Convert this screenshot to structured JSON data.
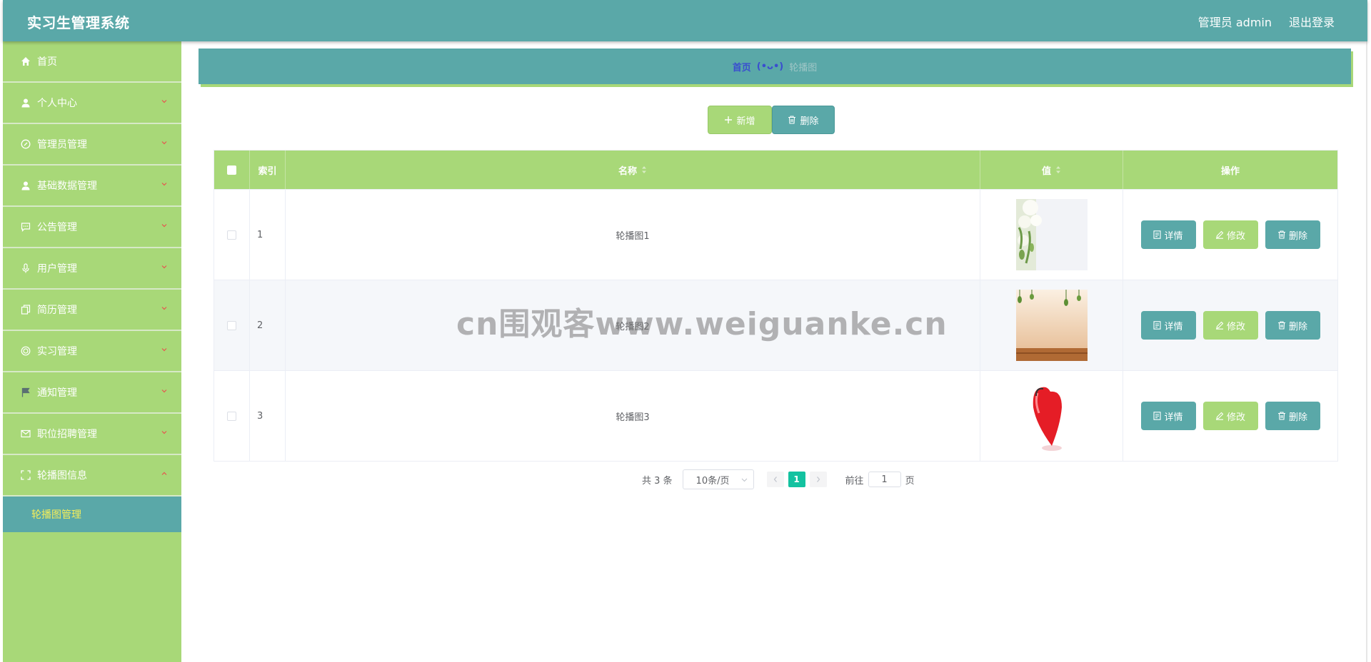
{
  "app": {
    "title": "实习生管理系统"
  },
  "header": {
    "user": "管理员 admin",
    "logout": "退出登录"
  },
  "sidebar": {
    "items": [
      {
        "label": "首页",
        "icon": "home-icon"
      },
      {
        "label": "个人中心",
        "icon": "user-icon"
      },
      {
        "label": "管理员管理",
        "icon": "compass-icon"
      },
      {
        "label": "基础数据管理",
        "icon": "user-icon"
      },
      {
        "label": "公告管理",
        "icon": "chat-icon"
      },
      {
        "label": "用户管理",
        "icon": "microphone-icon"
      },
      {
        "label": "简历管理",
        "icon": "copy-icon"
      },
      {
        "label": "实习管理",
        "icon": "target-icon"
      },
      {
        "label": "通知管理",
        "icon": "flag-icon"
      },
      {
        "label": "职位招聘管理",
        "icon": "mail-icon"
      },
      {
        "label": "轮播图信息",
        "icon": "fullscreen-icon"
      }
    ],
    "subitem": "轮播图管理"
  },
  "breadcrumb": {
    "home": "首页",
    "separator": "(•ᴗ•)",
    "current": "轮播图"
  },
  "toolbar": {
    "add_label": "新增",
    "delete_label": "删除"
  },
  "table": {
    "columns": [
      "索引",
      "名称",
      "值",
      "操作"
    ],
    "rows": [
      {
        "index": "1",
        "name": "轮播图1",
        "image": "white-flowers"
      },
      {
        "index": "2",
        "name": "轮播图2",
        "image": "hanging-leaves"
      },
      {
        "index": "3",
        "name": "轮播图3",
        "image": "red-heart"
      }
    ],
    "actions": {
      "detail": "详情",
      "edit": "修改",
      "delete": "删除"
    }
  },
  "pagination": {
    "total": "共 3 条",
    "page_size": "10条/页",
    "current_page": "1",
    "goto": "前往",
    "page_suffix": "页",
    "jump_value": "1"
  },
  "watermark": "cn围观客www.weiguanke.cn",
  "colors": {
    "header": "#5aa8a8",
    "sidebar": "#a8d878",
    "accent_yellow": "#f5ee5a",
    "page_active": "#13c2a0"
  }
}
